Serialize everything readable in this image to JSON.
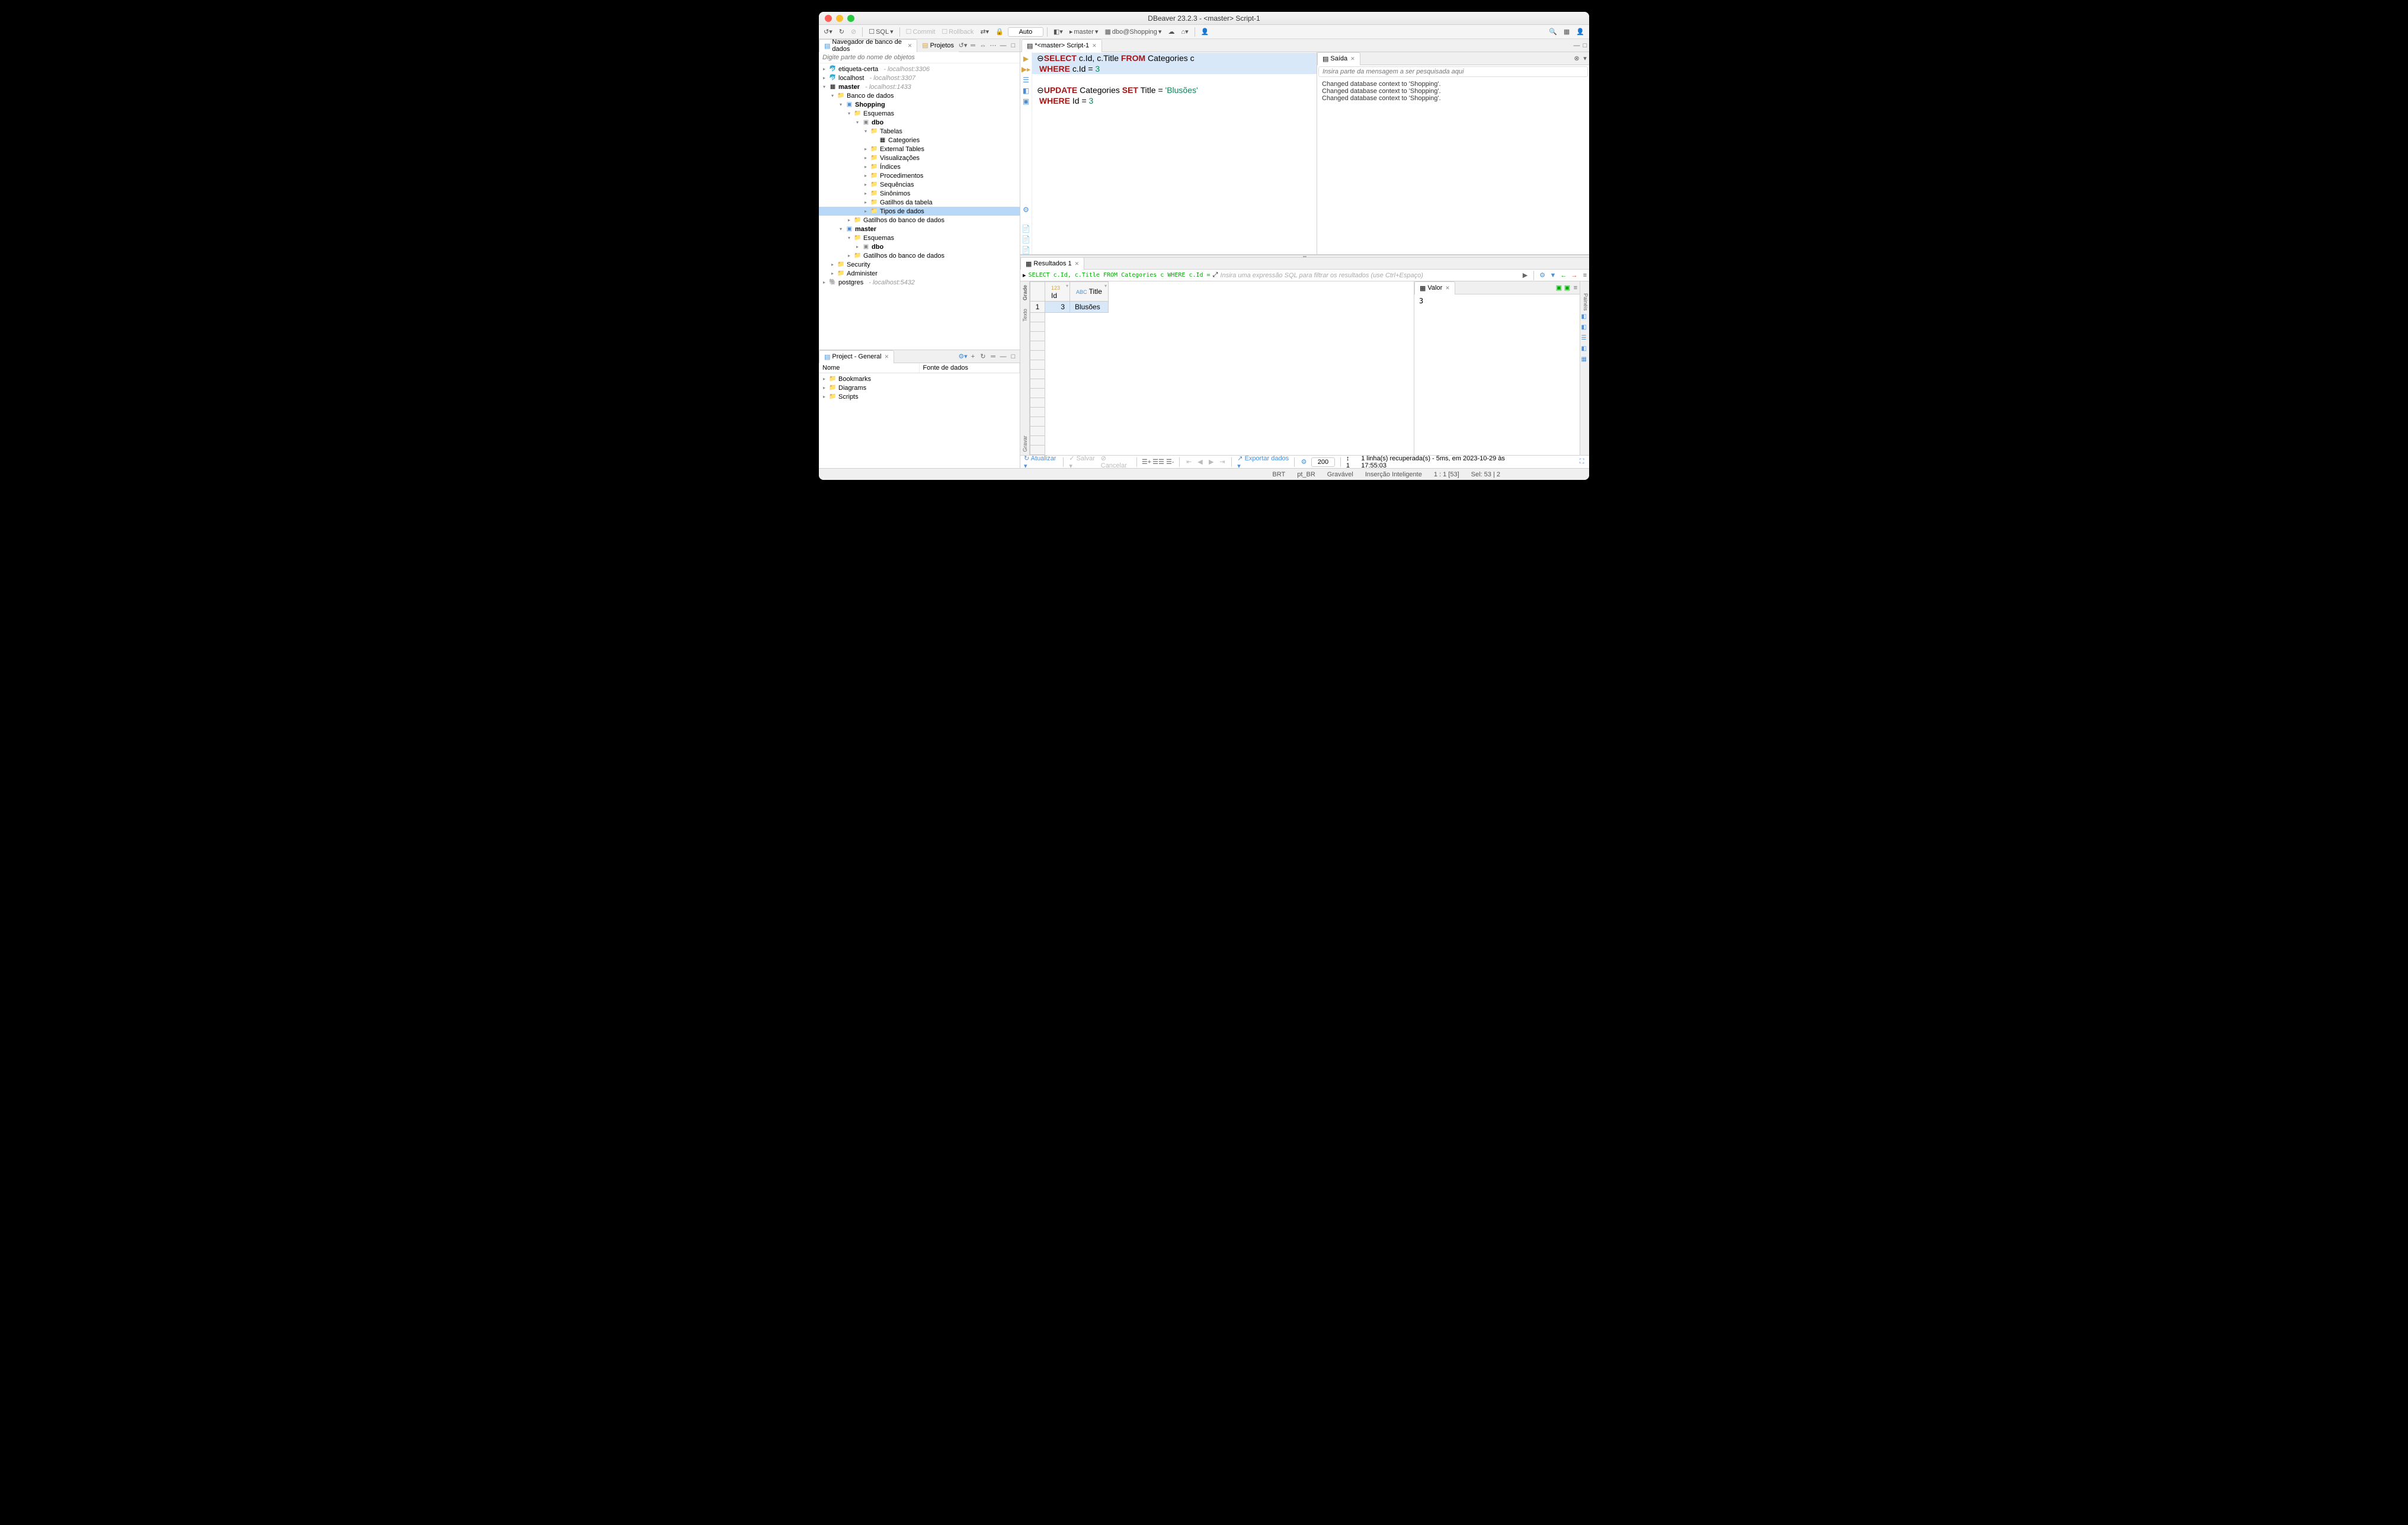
{
  "title": "DBeaver 23.2.3 - <master> Script-1",
  "toolbar": {
    "sql_label": "SQL",
    "commit_label": "Commit",
    "rollback_label": "Rollback",
    "auto_label": "Auto",
    "conn_label": "master",
    "db_label": "dbo@Shopping"
  },
  "left_panel": {
    "nav_tab": "Navegador de banco de dados",
    "projects_tab": "Projetos",
    "filter_placeholder": "Digite parte do nome de objetos",
    "tree": {
      "etiqueta": "etiqueta-certa",
      "etiqueta_host": "- localhost:3306",
      "localhost": "localhost",
      "localhost_host": "- localhost:3307",
      "master": "master",
      "master_host": "- localhost:1433",
      "bancos": "Banco de dados",
      "shopping": "Shopping",
      "esquemas": "Esquemas",
      "dbo": "dbo",
      "tabelas": "Tabelas",
      "categories": "Categories",
      "ext_tables": "External Tables",
      "views": "Visualizações",
      "indices": "Índices",
      "procs": "Procedimentos",
      "seqs": "Sequências",
      "synonyms": "Sinônimos",
      "triggers": "Gatilhos da tabela",
      "datatypes": "Tipos de dados",
      "db_triggers": "Gatilhos do banco de dados",
      "master2": "master",
      "esquemas2": "Esquemas",
      "dbo2": "dbo",
      "db_triggers2": "Gatilhos do banco de dados",
      "security": "Security",
      "administer": "Administer",
      "postgres": "postgres",
      "postgres_host": "- localhost:5432"
    },
    "project": {
      "title": "Project - General",
      "col_name": "Nome",
      "col_source": "Fonte de dados",
      "bookmarks": "Bookmarks",
      "diagrams": "Diagrams",
      "scripts": "Scripts"
    }
  },
  "editor": {
    "tab": "*<master> Script-1",
    "sql": {
      "l1_select": "SELECT",
      "l1_rest": " c.Id, c.Title ",
      "l1_from": "FROM",
      "l1_table": " Categories c",
      "l2_where": " WHERE",
      "l2_rest": " c.Id = ",
      "l2_num": "3",
      "l4_update": "UPDATE",
      "l4_rest": " Categories ",
      "l4_set": "SET",
      "l4_rest2": " Title = ",
      "l4_str": "'Blusões'",
      "l5_where": " WHERE",
      "l5_rest": " Id = ",
      "l5_num": "3"
    }
  },
  "output": {
    "tab": "Saída",
    "placeholder": "Insira parte da mensagem a ser pesquisada aqui",
    "lines": [
      "Changed database context to 'Shopping'.",
      "Changed database context to 'Shopping'.",
      "Changed database context to 'Shopping'."
    ]
  },
  "results": {
    "tab": "Resultados 1",
    "sql_text": "SELECT c.Id, c.Title FROM Categories c WHERE c.Id =",
    "filter_placeholder": "Insira uma expressão SQL para filtrar os resultados (use Ctrl+Espaço)",
    "side": {
      "grade": "Grade",
      "texto": "Texto",
      "gravar": "Gravar",
      "paineis": "Painéis"
    },
    "cols": {
      "id": "Id",
      "title": "Title"
    },
    "row": {
      "num": "1",
      "id": "3",
      "title": "Blusões"
    },
    "value_tab": "Valor",
    "value_content": "3",
    "bottom": {
      "refresh": "Atualizar",
      "save": "Salvar",
      "cancel": "Cancelar",
      "export": "Exportar dados",
      "rows": "200",
      "rownum": "1",
      "status": "1 linha(s) recuperada(s) - 5ms, em 2023-10-29 às 17:55:03"
    }
  },
  "statusbar": {
    "tz": "BRT",
    "locale": "pt_BR",
    "mode": "Gravável",
    "ins": "Inserção Inteligente",
    "pos": "1 : 1 [53]",
    "sel": "Sel: 53 | 2"
  }
}
